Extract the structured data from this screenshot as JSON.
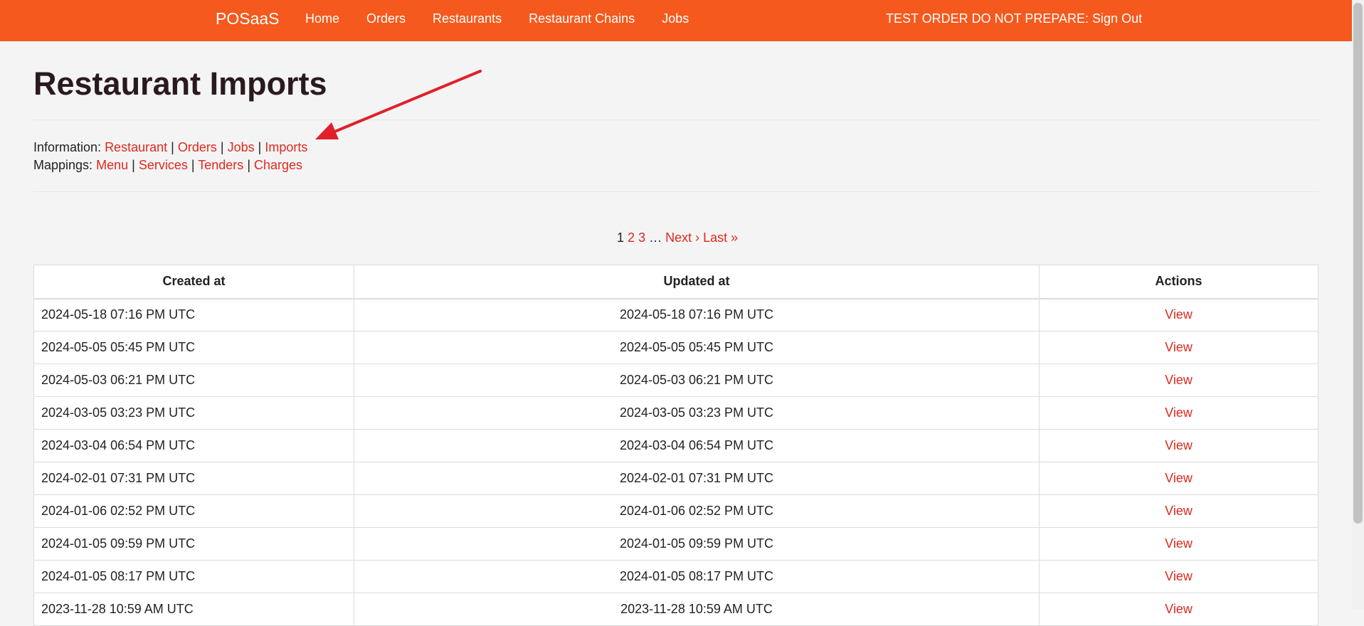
{
  "navbar": {
    "brand": "POSaaS",
    "links": [
      "Home",
      "Orders",
      "Restaurants",
      "Restaurant Chains",
      "Jobs"
    ],
    "user_text": "TEST ORDER DO NOT PREPARE: Sign Out"
  },
  "page": {
    "title": "Restaurant Imports",
    "information_label": "Information:",
    "information_links": [
      "Restaurant",
      "Orders",
      "Jobs",
      "Imports"
    ],
    "mappings_label": "Mappings:",
    "mappings_links": [
      "Menu",
      "Services",
      "Tenders",
      "Charges"
    ],
    "separator": "|"
  },
  "pagination": {
    "current": "1",
    "pages": [
      "2",
      "3"
    ],
    "ellipsis": "…",
    "next": "Next ›",
    "last": "Last »"
  },
  "table": {
    "headers": [
      "Created at",
      "Updated at",
      "Actions"
    ],
    "rows": [
      {
        "created": "2024-05-18 07:16 PM UTC",
        "updated": "2024-05-18 07:16 PM UTC",
        "action": "View"
      },
      {
        "created": "2024-05-05 05:45 PM UTC",
        "updated": "2024-05-05 05:45 PM UTC",
        "action": "View"
      },
      {
        "created": "2024-05-03 06:21 PM UTC",
        "updated": "2024-05-03 06:21 PM UTC",
        "action": "View"
      },
      {
        "created": "2024-03-05 03:23 PM UTC",
        "updated": "2024-03-05 03:23 PM UTC",
        "action": "View"
      },
      {
        "created": "2024-03-04 06:54 PM UTC",
        "updated": "2024-03-04 06:54 PM UTC",
        "action": "View"
      },
      {
        "created": "2024-02-01 07:31 PM UTC",
        "updated": "2024-02-01 07:31 PM UTC",
        "action": "View"
      },
      {
        "created": "2024-01-06 02:52 PM UTC",
        "updated": "2024-01-06 02:52 PM UTC",
        "action": "View"
      },
      {
        "created": "2024-01-05 09:59 PM UTC",
        "updated": "2024-01-05 09:59 PM UTC",
        "action": "View"
      },
      {
        "created": "2024-01-05 08:17 PM UTC",
        "updated": "2024-01-05 08:17 PM UTC",
        "action": "View"
      },
      {
        "created": "2023-11-28 10:59 AM UTC",
        "updated": "2023-11-28 10:59 AM UTC",
        "action": "View"
      }
    ]
  },
  "colors": {
    "navbar": "#f5591d",
    "link": "#e0281e",
    "annotation_arrow": "#e0202a"
  },
  "annotation": {
    "icon": "arrow-annotation-icon"
  }
}
